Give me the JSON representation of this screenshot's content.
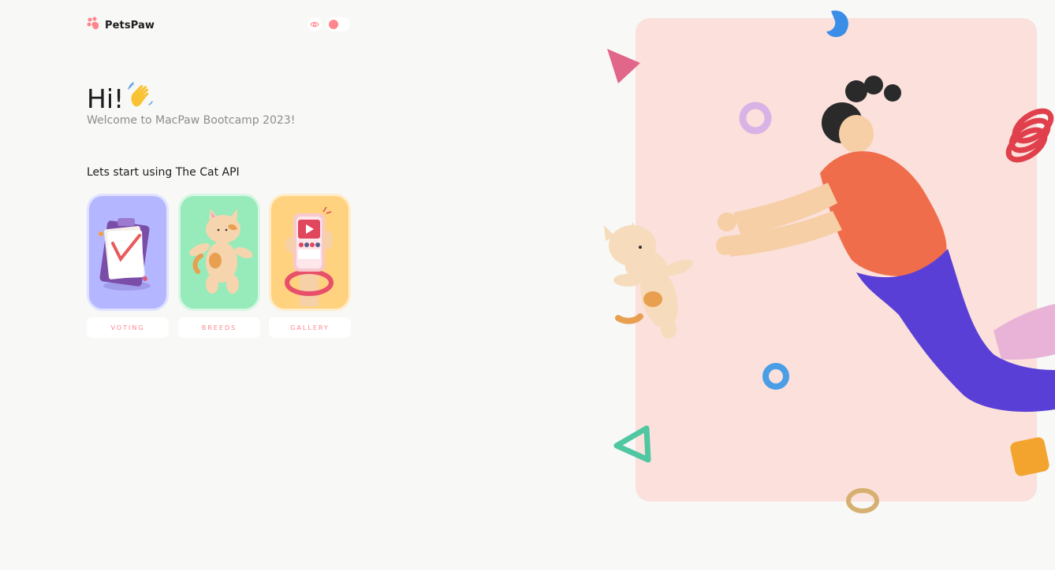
{
  "app": {
    "name": "PetsPaw"
  },
  "header": {
    "theme_mode": "light"
  },
  "hero": {
    "greeting": "Hi!",
    "subtitle": "Welcome to MacPaw Bootcamp 2023!"
  },
  "start": {
    "title": "Lets start using The Cat API"
  },
  "nav": [
    {
      "label": "VOTING",
      "color": "#b4b7ff"
    },
    {
      "label": "BREEDS",
      "color": "#97eab9"
    },
    {
      "label": "GALLERY",
      "color": "#ffd280"
    }
  ],
  "colors": {
    "accent": "#ff868e",
    "background": "#f8f8f7",
    "hero_panel": "#fbe0dc"
  },
  "icons": [
    "paw-logo-icon",
    "eye-icon",
    "waving-hand-icon",
    "clipboard-illustration",
    "cat-illustration",
    "phone-gallery-illustration",
    "girl-and-cat-illustration"
  ]
}
